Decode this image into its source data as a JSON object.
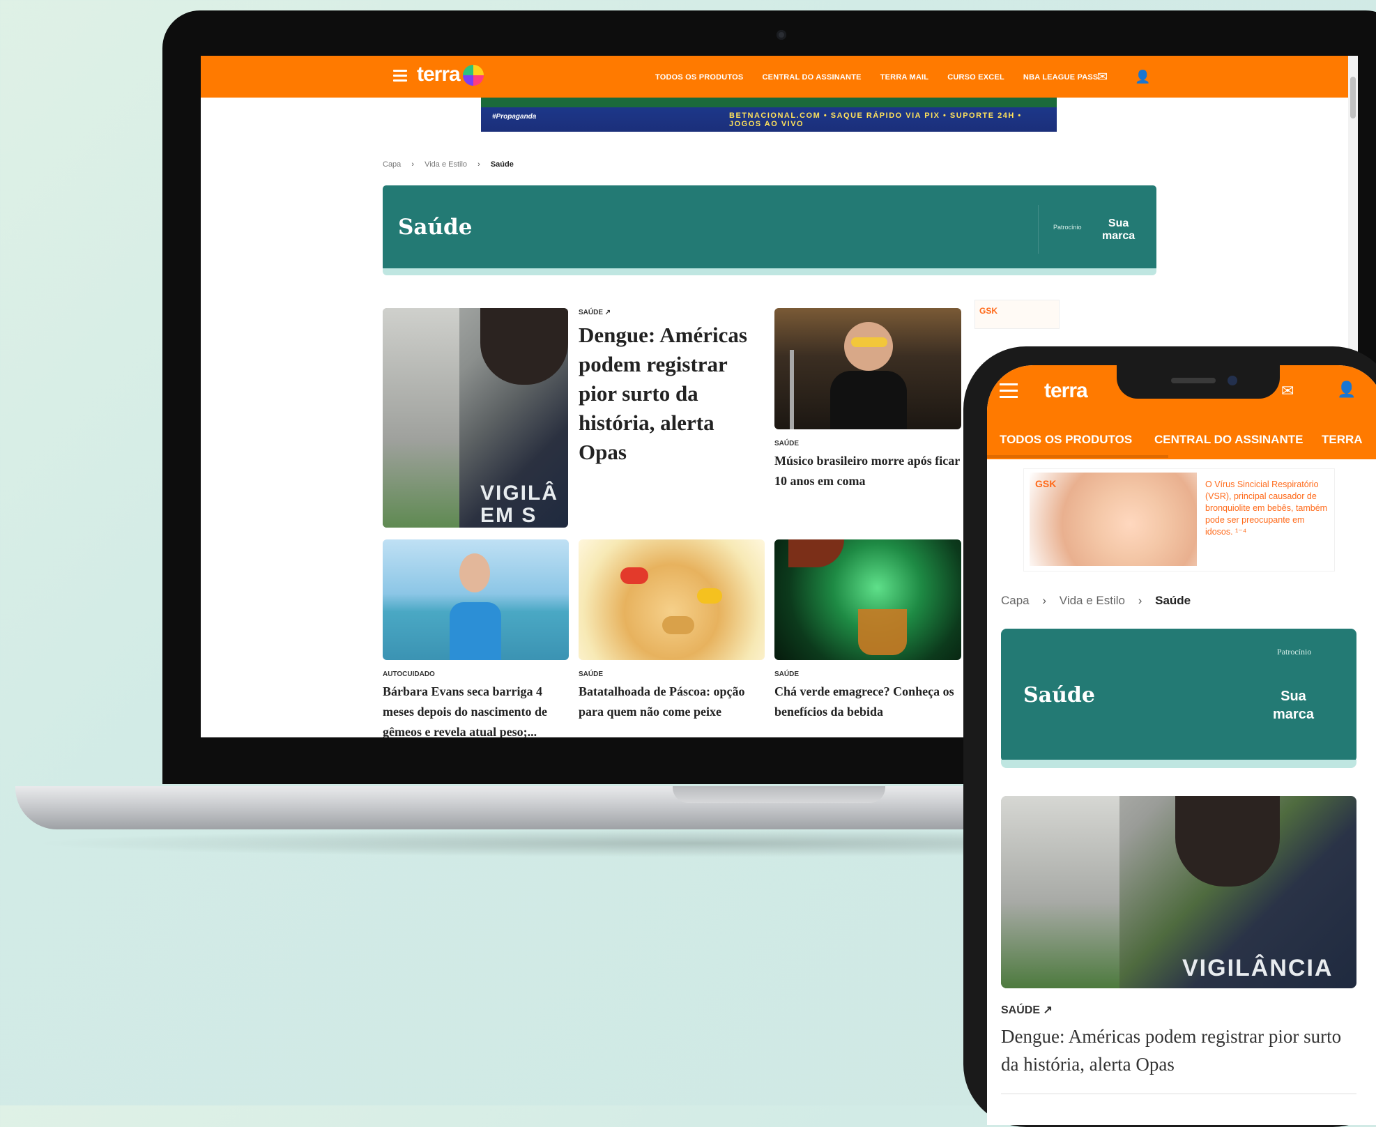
{
  "site": {
    "logo": "terra"
  },
  "laptop": {
    "nav_items": [
      "TODOS OS PRODUTOS",
      "CENTRAL DO ASSINANTE",
      "TERRA MAIL",
      "CURSO EXCEL",
      "NBA LEAGUE PASS"
    ],
    "ad": {
      "tag": "#Propaganda",
      "text": "BETNACIONAL.COM • SAQUE RÁPIDO VIA PIX • SUPORTE 24H • JOGOS AO VIVO"
    },
    "breadcrumb": {
      "home": "Capa",
      "section": "Vida e Estilo",
      "current": "Saúde"
    },
    "hero": {
      "title": "Saúde",
      "sponsor_label": "Patrocínio",
      "brand_line1": "Sua",
      "brand_line2": "marca"
    },
    "cards": {
      "main": {
        "tag": "SAÚDE ↗",
        "title": "Dengue: Américas podem registrar pior surto da história, alerta Opas",
        "image_text": "VIGILÂ EM S"
      },
      "music": {
        "tag": "SAÚDE",
        "title": "Músico brasileiro morre após ficar 10 anos em coma"
      },
      "barbara": {
        "tag": "AUTOCUIDADO",
        "title": "Bárbara Evans seca barriga 4 meses depois do nascimento de gêmeos e revela atual peso;..."
      },
      "pascoa": {
        "tag": "SAÚDE",
        "title": "Batatalhoada de Páscoa: opção para quem não come peixe"
      },
      "cha": {
        "tag": "SAÚDE",
        "title": "Chá verde emagrece? Conheça os benefícios da bebida"
      }
    },
    "side_ad": "GSK"
  },
  "phone": {
    "menu_items": [
      "TODOS OS PRODUTOS",
      "CENTRAL DO ASSINANTE",
      "TERRA"
    ],
    "ad": {
      "brand": "GSK",
      "text": "O Vírus Sincicial Respiratório (VSR), principal causador de bronquiolite em bebês, também pode ser preocupante em idosos. ¹⁻⁴"
    },
    "breadcrumb": {
      "home": "Capa",
      "section": "Vida e Estilo",
      "current": "Saúde"
    },
    "hero": {
      "title": "Saúde",
      "sponsor_label": "Patrocínio",
      "brand_line1": "Sua",
      "brand_line2": "marca"
    },
    "article": {
      "tag": "SAÚDE ↗",
      "title": "Dengue: Américas podem registrar pior surto da história, alerta Opas",
      "image_text": "VIGILÂNCIA"
    }
  },
  "colors": {
    "brand_orange": "#ff7a00",
    "section_teal": "#237a74"
  }
}
